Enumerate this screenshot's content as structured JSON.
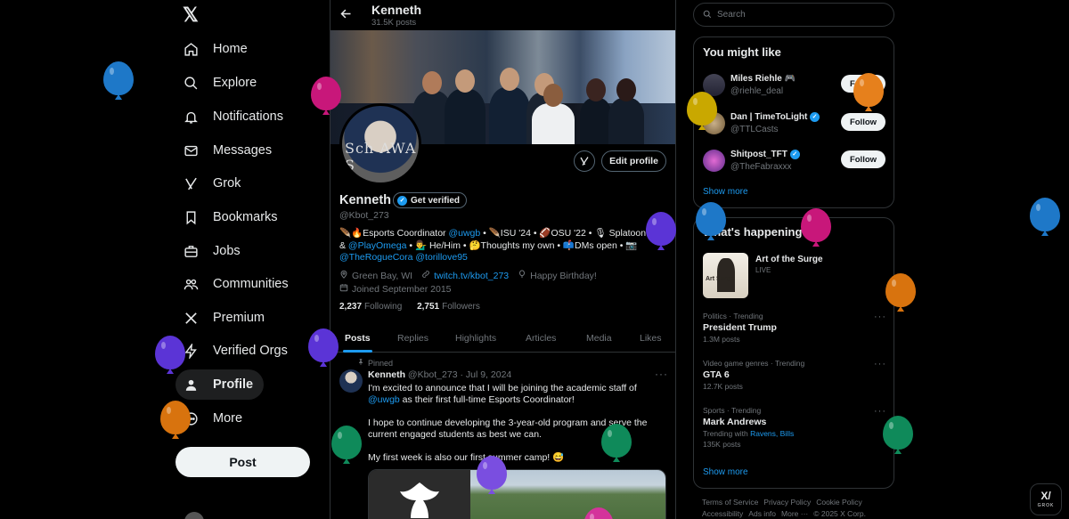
{
  "nav": {
    "logo": "𝕏",
    "items": [
      {
        "label": "Home",
        "icon": "home-icon"
      },
      {
        "label": "Explore",
        "icon": "search-icon"
      },
      {
        "label": "Notifications",
        "icon": "bell-icon"
      },
      {
        "label": "Messages",
        "icon": "envelope-icon"
      },
      {
        "label": "Grok",
        "icon": "grok-icon"
      },
      {
        "label": "Bookmarks",
        "icon": "bookmark-icon"
      },
      {
        "label": "Jobs",
        "icon": "briefcase-icon"
      },
      {
        "label": "Communities",
        "icon": "people-icon"
      },
      {
        "label": "Premium",
        "icon": "x-icon"
      },
      {
        "label": "Verified Orgs",
        "icon": "lightning-icon"
      },
      {
        "label": "Profile",
        "icon": "person-icon"
      },
      {
        "label": "More",
        "icon": "more-circle-icon"
      }
    ],
    "post_label": "Post"
  },
  "header": {
    "name": "Kenneth",
    "post_count": "31.5K posts"
  },
  "profile": {
    "avatar_text": "Sch  AWA S",
    "edit_label": "Edit profile",
    "name": "Kenneth",
    "verified_label": "Get verified",
    "handle": "@Kbot_273",
    "bio": {
      "p1": "🪶🔥Esports Coordinator ",
      "l1": "@uwgb",
      "p2": " • 🪶ISU '24 • 🏈OSU '22 • 🎙 Splatoon & ",
      "l2": "@PlayOmega",
      "p3": " • 💁‍♂️ He/Him • 🤔Thoughts my own • 📫DMs open • 📷 ",
      "l3": "@TheRogueCora",
      "p4": " ",
      "l4": "@torillove95"
    },
    "location": "Green Bay, WI",
    "website": "twitch.tv/kbot_273",
    "birthday": "Happy Birthday!",
    "joined": "Joined September 2015",
    "following_count": "2,237",
    "following_label": "Following",
    "followers_count": "2,751",
    "followers_label": "Followers"
  },
  "tabs": [
    "Posts",
    "Replies",
    "Highlights",
    "Articles",
    "Media",
    "Likes"
  ],
  "tweet": {
    "pinned_label": "Pinned",
    "name": "Kenneth",
    "meta": "@Kbot_273 · Jul 9, 2024",
    "line1_a": "I'm excited to announce that I will be joining the academic staff of ",
    "line1_link": "@uwgb",
    "line1_b": " as their first full-time Esports Coordinator!",
    "para2": "I hope to continue developing the 3-year-old program and serve the current engaged students as best we can.",
    "para3": "My first week is also our first summer camp! 😅"
  },
  "search": {
    "placeholder": "Search"
  },
  "might_like": {
    "title": "You might like",
    "users": [
      {
        "name": "Miles Riehle 🎮",
        "handle": "@riehle_deal",
        "verified": false
      },
      {
        "name": "Dan | TimeToLight",
        "handle": "@TTLCasts",
        "verified": true
      },
      {
        "name": "Shitpost_TFT",
        "handle": "@TheFabraxxx",
        "verified": true
      }
    ],
    "follow_label": "Follow",
    "show_more": "Show more"
  },
  "happening": {
    "title": "What's happening",
    "featured": {
      "title": "Art of the Surge",
      "status": "LIVE",
      "thumb_text": "Art Surge"
    },
    "trends": [
      {
        "category": "Politics · Trending",
        "title": "President Trump",
        "count": "1.3M posts"
      },
      {
        "category": "Video game genres · Trending",
        "title": "GTA 6",
        "count": "12.7K posts"
      },
      {
        "category": "Sports · Trending",
        "title": "Mark Andrews",
        "with_label": "Trending with ",
        "with_links": "Ravens, Bills",
        "count": "135K posts"
      }
    ],
    "show_more": "Show more"
  },
  "footer": {
    "row1": [
      "Terms of Service",
      "Privacy Policy",
      "Cookie Policy"
    ],
    "row2": [
      "Accessibility",
      "Ads info",
      "More ···",
      "© 2025 X Corp."
    ]
  },
  "grok_float": {
    "glyph": "X/",
    "label": "GROK"
  },
  "colors": {
    "accent": "#1d9bf0",
    "background": "#000000",
    "border": "#2f3336",
    "muted": "#71767b"
  }
}
